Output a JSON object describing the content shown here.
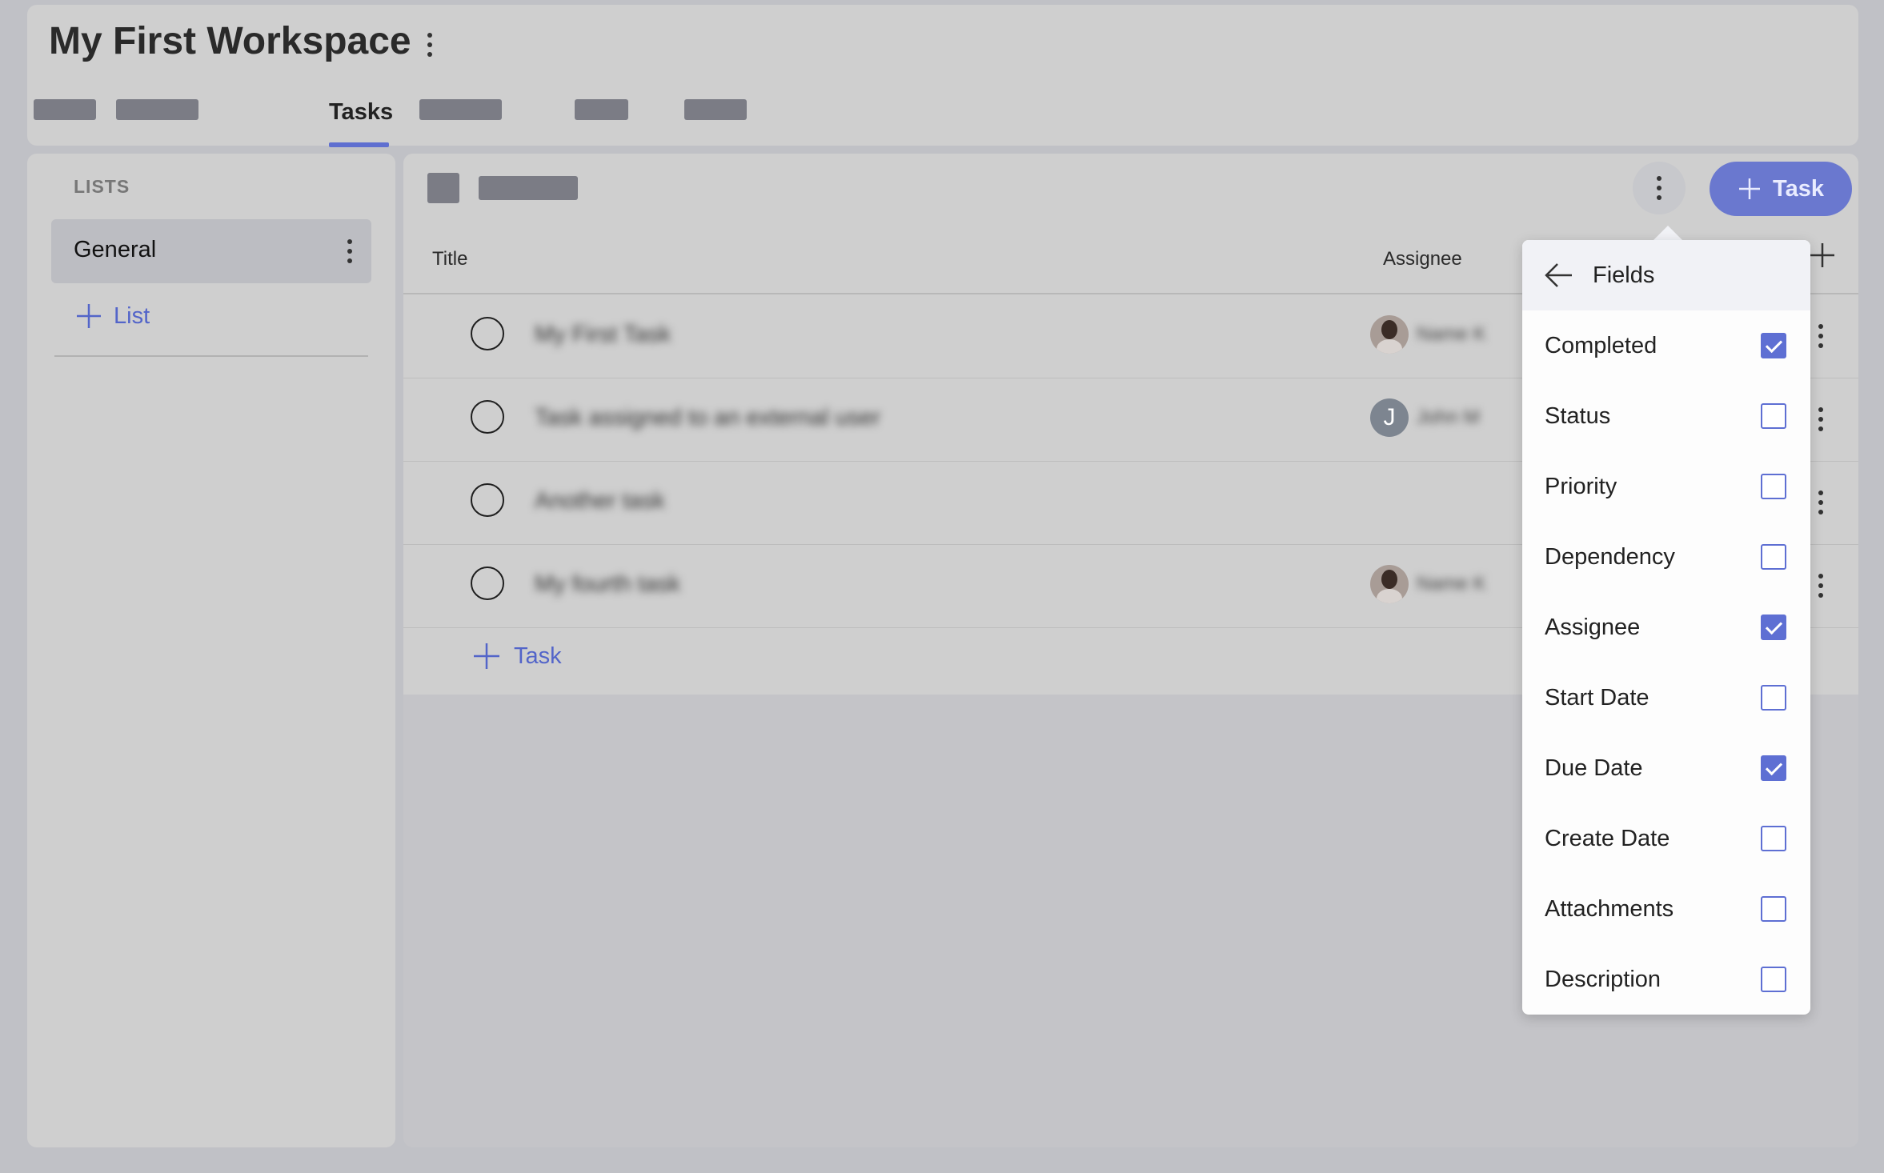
{
  "header": {
    "workspace_title": "My First Workspace",
    "active_tab": "Tasks"
  },
  "sidebar": {
    "heading": "LISTS",
    "lists": [
      {
        "label": "General"
      }
    ],
    "add_list_label": "List"
  },
  "table": {
    "columns": [
      "Title",
      "Assignee"
    ],
    "rows": [
      {
        "title": "My First Task",
        "assignee": "Name K",
        "avatar": "photo"
      },
      {
        "title": "Task assigned to an external user",
        "assignee": "John M",
        "avatar": "letter",
        "initial": "J"
      },
      {
        "title": "Another task",
        "assignee": "",
        "avatar": ""
      },
      {
        "title": "My fourth task",
        "assignee": "Name K",
        "avatar": "photo"
      }
    ],
    "add_task_label": "Task"
  },
  "toolbar": {
    "add_task_button_label": "Task"
  },
  "fields_popup": {
    "title": "Fields",
    "fields": [
      {
        "label": "Completed",
        "checked": true
      },
      {
        "label": "Status",
        "checked": false
      },
      {
        "label": "Priority",
        "checked": false
      },
      {
        "label": "Dependency",
        "checked": false
      },
      {
        "label": "Assignee",
        "checked": true
      },
      {
        "label": "Start Date",
        "checked": false
      },
      {
        "label": "Due Date",
        "checked": true
      },
      {
        "label": "Create Date",
        "checked": false
      },
      {
        "label": "Attachments",
        "checked": false
      },
      {
        "label": "Description",
        "checked": false
      }
    ]
  },
  "colors": {
    "accent": "#5e6fd3",
    "link": "#5365c9",
    "primary_button": "#6a78cf"
  }
}
